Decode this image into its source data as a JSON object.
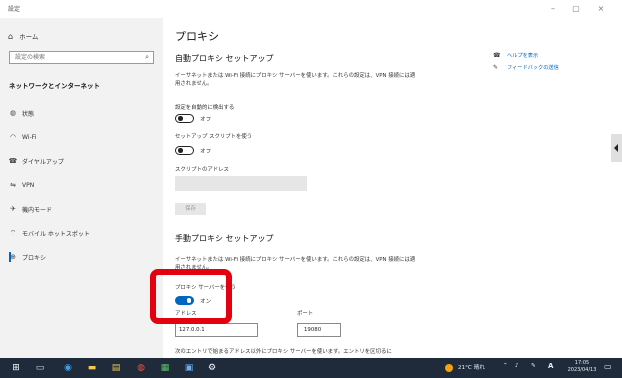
{
  "window": {
    "title": "設定",
    "minimize": "–",
    "maximize": "▢",
    "close": "×"
  },
  "sidebar": {
    "home_label": "ホーム",
    "search_placeholder": "設定の検索",
    "section_title": "ネットワークとインターネット",
    "items": [
      {
        "label": "状態",
        "icon": "status-icon"
      },
      {
        "label": "Wi-Fi",
        "icon": "wifi-icon"
      },
      {
        "label": "ダイヤルアップ",
        "icon": "phone-icon"
      },
      {
        "label": "VPN",
        "icon": "vpn-icon"
      },
      {
        "label": "機内モード",
        "icon": "airplane-icon"
      },
      {
        "label": "モバイル ホットスポット",
        "icon": "hotspot-icon"
      },
      {
        "label": "プロキシ",
        "icon": "globe-icon",
        "active": true
      }
    ]
  },
  "main": {
    "page_title": "プロキシ",
    "auto_heading": "自動プロキシ セットアップ",
    "auto_desc": "イーサネットまたは Wi-Fi 接続にプロキシ サーバーを使います。これらの設定は、VPN 接続には適用されません。",
    "auto_detect_label": "設定を自動的に検出する",
    "auto_detect_state": "オフ",
    "setup_script_label": "セットアップ スクリプトを使う",
    "setup_script_state": "オフ",
    "script_address_label": "スクリプトのアドレス",
    "save_label": "保存",
    "manual_heading": "手動プロキシ セットアップ",
    "manual_desc": "イーサネットまたは Wi-Fi 接続にプロキシ サーバーを使います。これらの設定は、VPN 接続には適用されません。",
    "use_proxy_label": "プロキシ サーバーを使う",
    "use_proxy_state": "オン",
    "address_label": "アドレス",
    "address_value": "127.0.0.1",
    "port_label": "ポート",
    "port_value": "19080",
    "exceptions_desc": "次のエントリで始まるアドレス以外にプロキシ サーバーを使います。エントリを区切るに"
  },
  "help": {
    "show_help": "ヘルプを表示",
    "feedback": "フィードバックの送信"
  },
  "taskbar": {
    "weather": "21°C 晴れ",
    "ime": "A",
    "time": "17:05",
    "date": "2023/04/13"
  },
  "colors": {
    "accent": "#0067c0",
    "highlight": "#e3000f",
    "taskbar": "#1f2a3a"
  }
}
